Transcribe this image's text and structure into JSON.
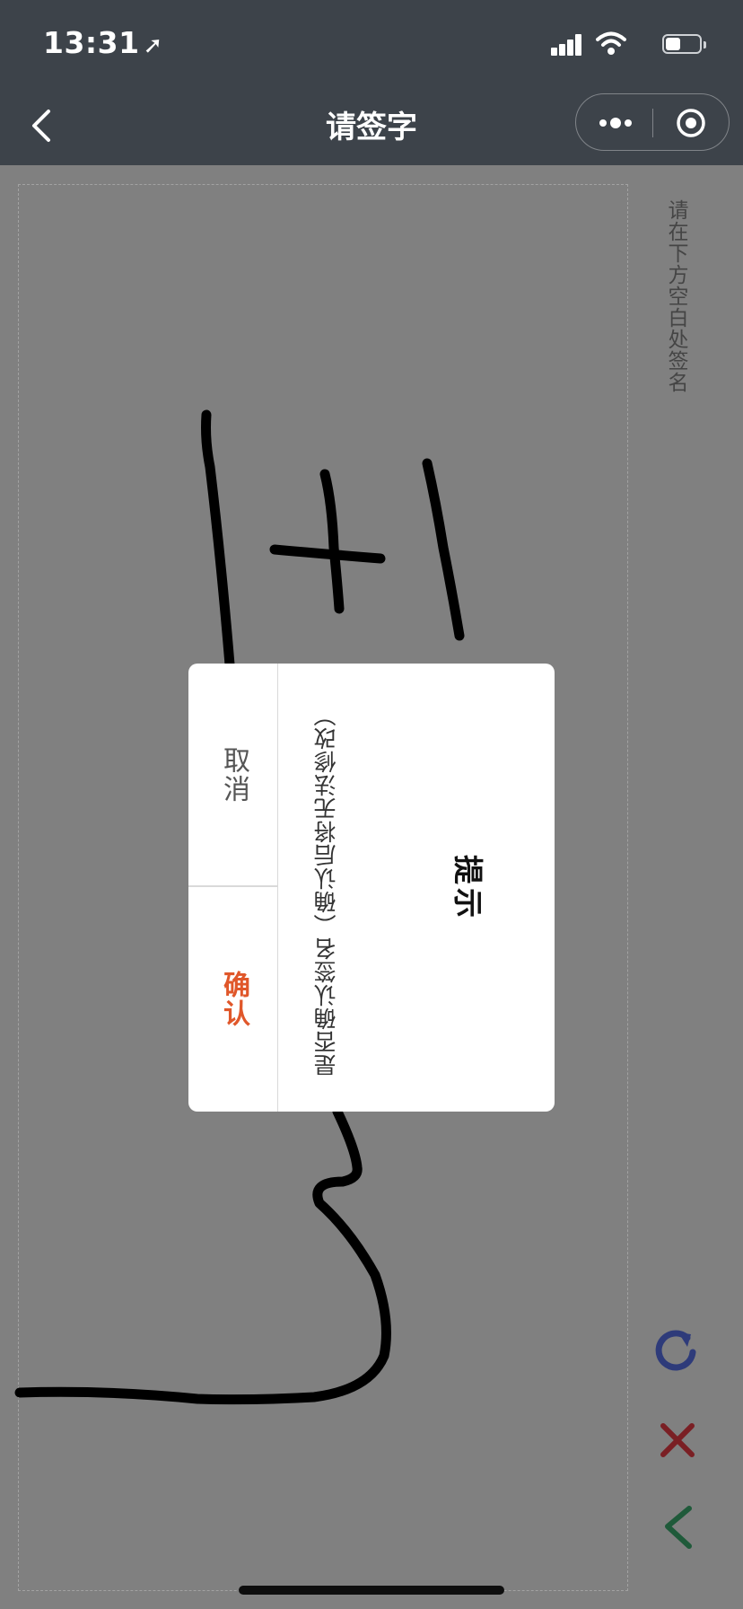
{
  "status_bar": {
    "time": "13:31",
    "icons": [
      "location-arrow-icon",
      "cellular-signal-icon",
      "wifi-icon",
      "battery-icon"
    ]
  },
  "nav": {
    "title": "请签字",
    "back_icon": "chevron-left-icon",
    "more_icon": "more-dots-icon",
    "close_icon": "target-circle-icon"
  },
  "canvas": {
    "hint": "请在下方空白处签名"
  },
  "tools": {
    "redo_icon": "redo-icon",
    "clear_icon": "close-x-icon",
    "back_icon": "chevron-left-icon",
    "colors": {
      "redo": "#2e3b7a",
      "clear": "#7a1f24",
      "back": "#1f5a3a"
    }
  },
  "dialog": {
    "title": "提示",
    "message": "是否确认签名（确认后将无法修改）",
    "cancel_label": "取消",
    "confirm_label": "确认",
    "confirm_color": "#e0572a"
  }
}
